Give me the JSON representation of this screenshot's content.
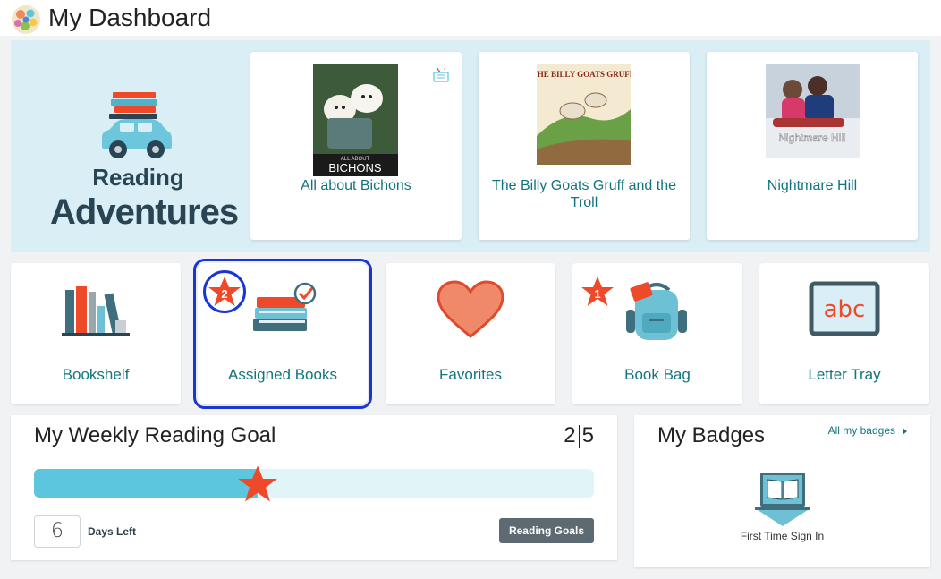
{
  "header": {
    "title": "My Dashboard",
    "logo_icon": "colorful-circle-logo-icon"
  },
  "banner": {
    "line1": "Reading",
    "line2": "Adventures",
    "books": [
      {
        "title": "All about Bichons",
        "cover_text": "BICHONS",
        "cover_caption": "ALL ABOUT",
        "action_icon": "reassign-book-icon"
      },
      {
        "title": "The Billy Goats Gruff and the Troll",
        "cover_text": "THE BILLY GOATS GRUFF"
      },
      {
        "title": "Nightmare Hill",
        "cover_text": "Nightmare Hill"
      }
    ]
  },
  "tiles": [
    {
      "label": "Bookshelf",
      "icon": "bookshelf-icon"
    },
    {
      "label": "Assigned Books",
      "icon": "assigned-books-icon",
      "badge": "2",
      "selected": true
    },
    {
      "label": "Favorites",
      "icon": "heart-icon"
    },
    {
      "label": "Book Bag",
      "icon": "backpack-icon",
      "badge": "1"
    },
    {
      "label": "Letter Tray",
      "icon": "letter-tray-icon",
      "tray_text": "abc"
    }
  ],
  "goal": {
    "title": "My Weekly Reading Goal",
    "completed": "2",
    "target": "5",
    "progress": 0.4,
    "days_left": "6",
    "days_label": "Days Left",
    "button_label": "Reading Goals"
  },
  "badges": {
    "title": "My Badges",
    "link_label": "All my badges",
    "items": [
      {
        "label": "First Time Sign In",
        "icon": "open-book-laptop-icon"
      }
    ]
  },
  "colors": {
    "teal_text": "#13747f",
    "accent_red": "#ee4a2a",
    "progress_fill": "#5bc6dd",
    "selection_blue": "#1a35d6",
    "banner_bg": "#daeef5"
  }
}
